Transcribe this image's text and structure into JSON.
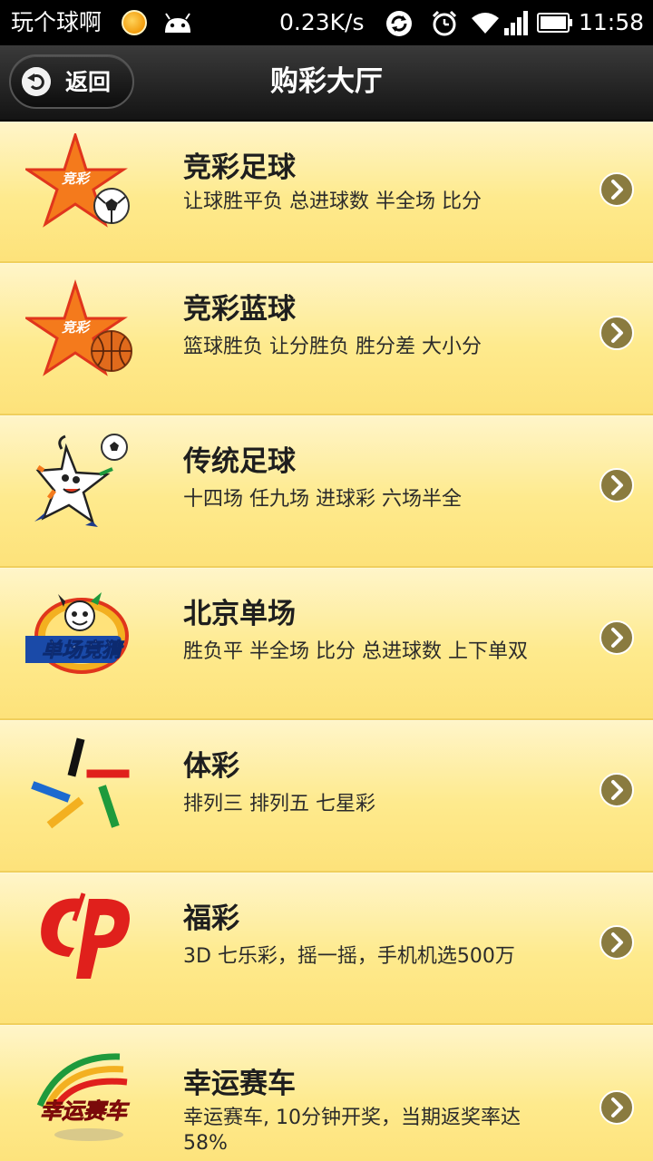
{
  "status_bar": {
    "app_name": "玩个球啊",
    "net_speed": "0.23K/s",
    "time": "11:58",
    "icons": [
      "sun-notification-icon",
      "android-icon",
      "sync-icon",
      "alarm-icon",
      "wifi-icon",
      "signal-icon",
      "battery-icon"
    ]
  },
  "header": {
    "back_label": "返回",
    "title": "购彩大厅"
  },
  "colors": {
    "row_background": "#fde889",
    "title_bar": "#1e1e1e",
    "arrow_circle": "#8a7b3f"
  },
  "lottery_items": [
    {
      "name": "竞彩足球",
      "desc": "让球胜平负 总进球数 半全场 比分",
      "icon": "jingcai-football-icon"
    },
    {
      "name": "竞彩蓝球",
      "desc": "篮球胜负 让分胜负 胜分差 大小分",
      "icon": "jingcai-basketball-icon"
    },
    {
      "name": "传统足球",
      "desc": "十四场 任九场 进球彩 六场半全",
      "icon": "traditional-football-mascot-icon"
    },
    {
      "name": "北京单场",
      "desc": "胜负平 半全场 比分 总进球数 上下单双",
      "icon": "beijing-single-logo-icon",
      "logo_text": "单场竞猜"
    },
    {
      "name": "体彩",
      "desc": "排列三 排列五 七星彩",
      "icon": "sports-lottery-star-icon"
    },
    {
      "name": "福彩",
      "desc": "3D 七乐彩，摇一摇，手机机选500万",
      "icon": "welfare-lottery-cp-icon"
    },
    {
      "name": "幸运赛车",
      "desc": "幸运赛车, 10分钟开奖，当期返奖率达58%",
      "icon": "lucky-racing-logo-icon",
      "logo_text": "幸运赛车"
    }
  ]
}
